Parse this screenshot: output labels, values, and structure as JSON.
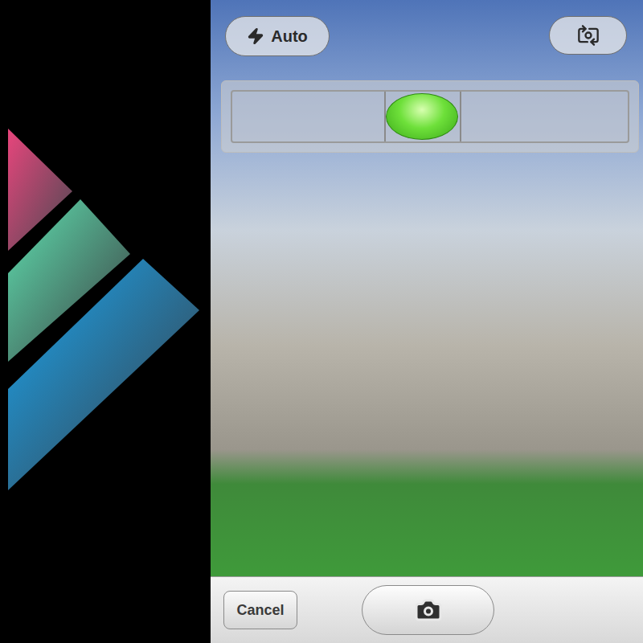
{
  "flash": {
    "label": "Auto"
  },
  "level_indicator": {
    "level": 0.48
  },
  "toolbar": {
    "cancel": "Cancel"
  }
}
